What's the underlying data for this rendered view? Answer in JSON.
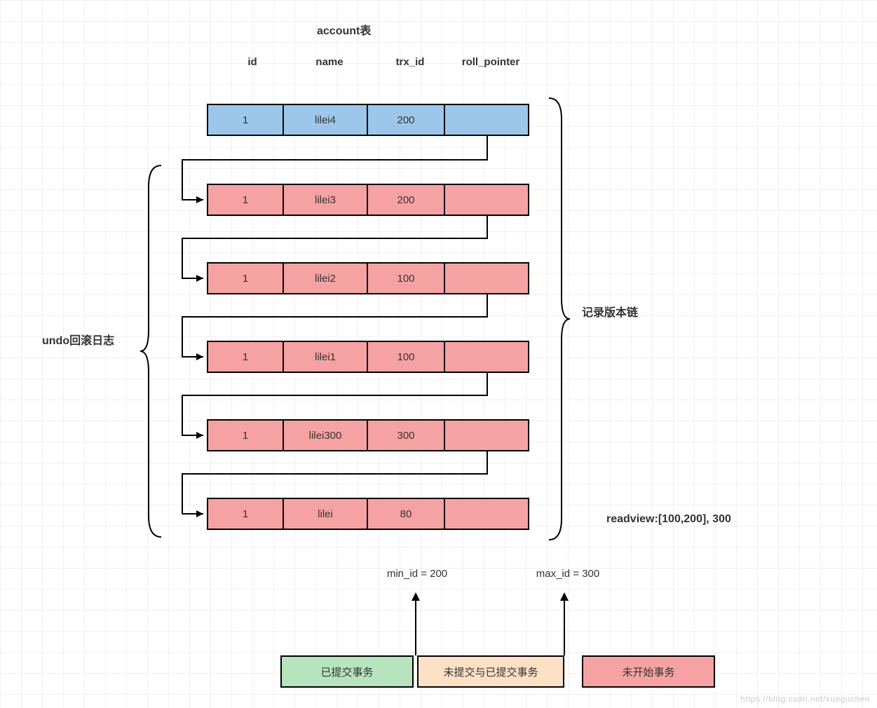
{
  "title": "account表",
  "columns": {
    "id": "id",
    "name": "name",
    "trx": "trx_id",
    "roll": "roll_pointer"
  },
  "rows": [
    {
      "id": "1",
      "name": "lilei4",
      "trx": "200",
      "color": "blue"
    },
    {
      "id": "1",
      "name": "lilei3",
      "trx": "200",
      "color": "pink"
    },
    {
      "id": "1",
      "name": "lilei2",
      "trx": "100",
      "color": "pink"
    },
    {
      "id": "1",
      "name": "lilei1",
      "trx": "100",
      "color": "pink"
    },
    {
      "id": "1",
      "name": "lilei300",
      "trx": "300",
      "color": "pink"
    },
    {
      "id": "1",
      "name": "lilei",
      "trx": "80",
      "color": "pink"
    }
  ],
  "labels": {
    "undo": "undo回滚日志",
    "chain": "记录版本链",
    "readview": "readview:[100,200], 300",
    "min_id": "min_id = 200",
    "max_id": "max_id = 300"
  },
  "legend": {
    "committed": "已提交事务",
    "mixed": "未提交与已提交事务",
    "notstarted": "未开始事务"
  },
  "watermark": "https://blog.csdn.net/xueguchen"
}
